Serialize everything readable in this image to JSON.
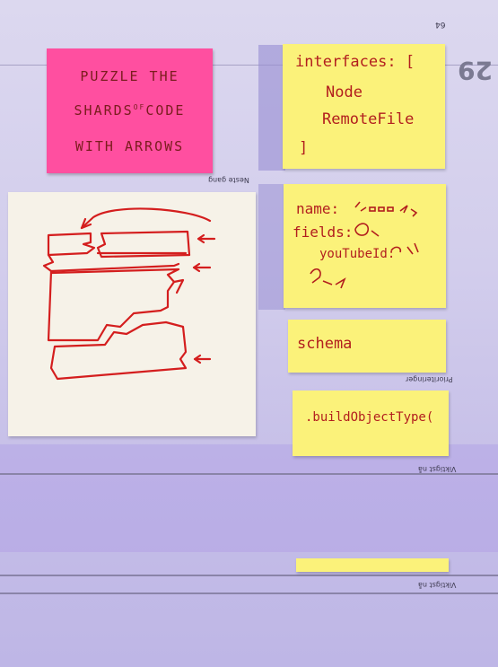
{
  "page": {
    "top_number": "64",
    "page_number": "29",
    "labels": {
      "neste_gang": "Neste gang",
      "prioriteringer": "Prioriteringer",
      "viktigst_1": "Viktigst nå",
      "viktigst_2": "Viktigst nå"
    }
  },
  "pink_note": {
    "line1": "PUZZLE THE",
    "line2": "SHARDS",
    "line2_small": "OF",
    "line2_end": "CODE",
    "line3": "WITH ARROWS"
  },
  "note_interfaces": {
    "line1": "interfaces: [",
    "line2": "Node",
    "line3": "RemoteFile",
    "line4": "]"
  },
  "note_fields": {
    "line1": "name:",
    "line2": "fields:",
    "line3": "youTubeId:"
  },
  "note_schema": {
    "text": "schema"
  },
  "note_build": {
    "text": ".buildObjectType("
  },
  "colors": {
    "pink": "#ff4fa0",
    "yellow": "#fbf27a",
    "ink": "#b21e1e",
    "paper": "#d2cdec"
  }
}
